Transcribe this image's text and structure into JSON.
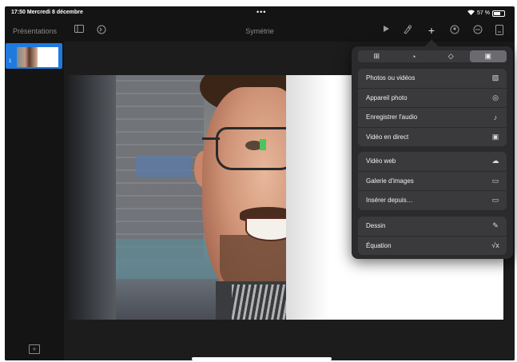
{
  "status": {
    "time": "17:50",
    "date": "Mercredi 8 décembre",
    "dots": "•••",
    "wifi_icon": "wifi-icon",
    "battery": "57 %"
  },
  "toolbar": {
    "presentations_label": "Présentations",
    "title": "Symétrie",
    "icons": [
      "sidebar-icon",
      "undo-icon",
      "play-icon",
      "brush-icon",
      "plus-icon",
      "collaborate-icon",
      "more-icon",
      "document-icon"
    ]
  },
  "sidebar": {
    "slides": [
      {
        "number": "1",
        "selected": true
      }
    ],
    "add_slide_icon": "add-slide-icon"
  },
  "popover": {
    "tabs": [
      {
        "icon": "table-icon",
        "glyph": "⊞",
        "active": false
      },
      {
        "icon": "chart-icon",
        "glyph": "◔",
        "active": false
      },
      {
        "icon": "shape-icon",
        "glyph": "◇",
        "active": false
      },
      {
        "icon": "media-icon",
        "glyph": "▣",
        "active": true
      }
    ],
    "groups": [
      {
        "items": [
          {
            "label": "Photos ou vidéos",
            "icon": "photo-icon",
            "glyph": "▨"
          },
          {
            "label": "Appareil photo",
            "icon": "camera-icon",
            "glyph": "◎"
          },
          {
            "label": "Enregistrer l'audio",
            "icon": "microphone-icon",
            "glyph": "♪"
          },
          {
            "label": "Vidéo en direct",
            "icon": "live-video-icon",
            "glyph": "▣"
          }
        ]
      },
      {
        "items": [
          {
            "label": "Vidéo web",
            "icon": "web-video-icon",
            "glyph": "☁"
          },
          {
            "label": "Galerie d'images",
            "icon": "gallery-icon",
            "glyph": "▭"
          },
          {
            "label": "Insérer depuis…",
            "icon": "folder-icon",
            "glyph": "▭"
          }
        ]
      },
      {
        "items": [
          {
            "label": "Dessin",
            "icon": "drawing-icon",
            "glyph": "✎"
          },
          {
            "label": "Équation",
            "icon": "equation-icon",
            "glyph": "√x"
          }
        ]
      }
    ]
  }
}
